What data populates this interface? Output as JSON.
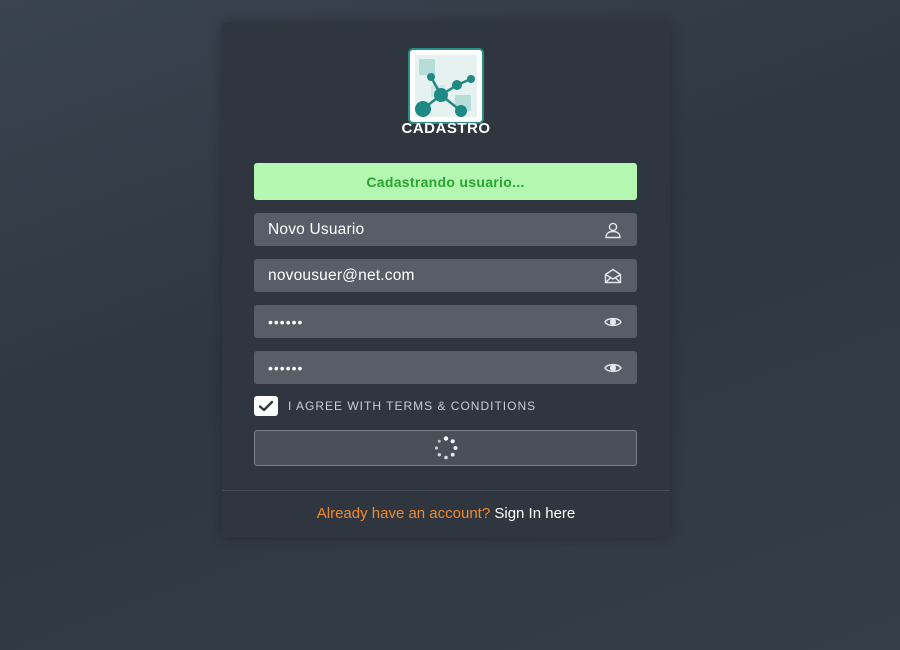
{
  "form": {
    "title": "CADASTRO",
    "status_message": "Cadastrando usuario...",
    "fields": [
      {
        "name": "username",
        "value": "Novo Usuario",
        "icon": "user-icon"
      },
      {
        "name": "email",
        "value": "novousuer@net.com",
        "icon": "envelope-icon"
      },
      {
        "name": "password",
        "value": "••••••",
        "icon": "eye-icon"
      },
      {
        "name": "confirm_password",
        "value": "••••••",
        "icon": "eye-icon"
      }
    ],
    "terms_checked": true,
    "terms_label": "I AGREE WITH TERMS & CONDITIONS",
    "submit_state": "loading"
  },
  "footer": {
    "question": "Already have an account?",
    "link": "Sign In here"
  },
  "colors": {
    "status_bg": "#b3f7b0",
    "status_text": "#27a52f",
    "accent": "#f08a2c",
    "card_bg": "#2f3640",
    "field_bg": "#575e67"
  }
}
